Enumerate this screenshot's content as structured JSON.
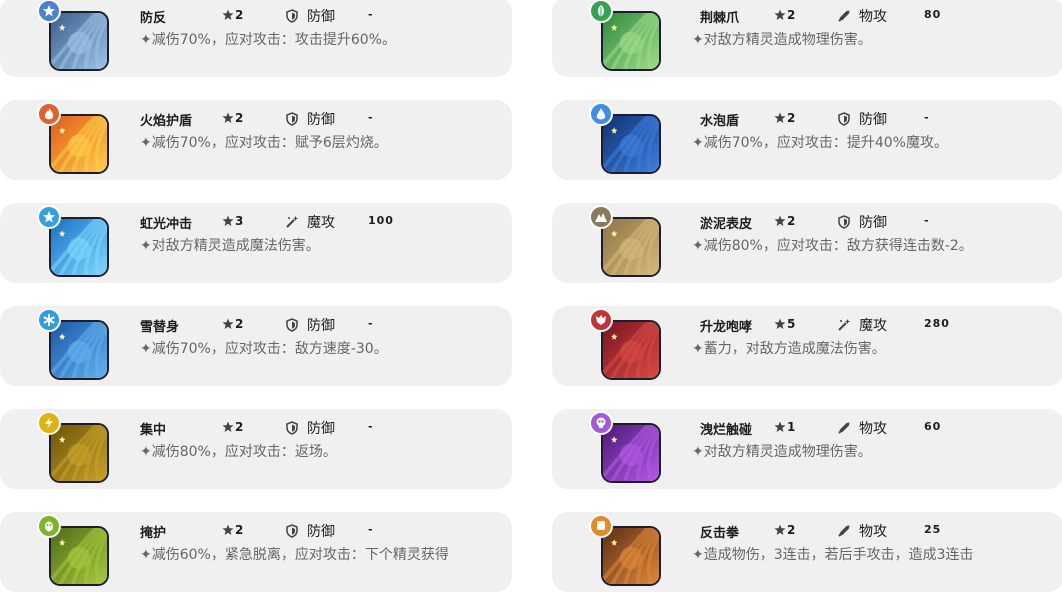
{
  "skills": [
    {
      "name": "防反",
      "cost": "2",
      "category": "防御",
      "power": "-",
      "desc": "✦减伤70%，应对攻击：攻击提升60%。",
      "element_icon": "light-icon",
      "element_color": "#4c82c9",
      "art_colors": [
        "#3b5d8c",
        "#9cc3e6"
      ]
    },
    {
      "name": "荆棘爪",
      "cost": "2",
      "category": "物攻",
      "power": "80",
      "desc": "✦对敌方精灵造成物理伤害。",
      "element_icon": "grass-icon",
      "element_color": "#3aa153",
      "art_colors": [
        "#2f8a3c",
        "#9fdc8b"
      ]
    },
    {
      "name": "火焰护盾",
      "cost": "2",
      "category": "防御",
      "power": "-",
      "desc": "✦减伤70%，应对攻击：赋予6层灼烧。",
      "element_icon": "fire-icon",
      "element_color": "#e1602e",
      "art_colors": [
        "#e05a1a",
        "#ffcf4a"
      ]
    },
    {
      "name": "水泡盾",
      "cost": "2",
      "category": "防御",
      "power": "-",
      "desc": "✦减伤70%，应对攻击：提升40%魔攻。",
      "element_icon": "water-icon",
      "element_color": "#3e8ee6",
      "art_colors": [
        "#10306e",
        "#3d7fe0"
      ]
    },
    {
      "name": "虹光冲击",
      "cost": "3",
      "category": "魔攻",
      "power": "100",
      "desc": "✦对敌方精灵造成魔法伤害。",
      "element_icon": "light-icon",
      "element_color": "#35a0e0",
      "art_colors": [
        "#1b6fc4",
        "#7fd8ff"
      ]
    },
    {
      "name": "淤泥表皮",
      "cost": "2",
      "category": "防御",
      "power": "-",
      "desc": "✦减伤80%，应对攻击：敌方获得连击数-2。",
      "element_icon": "ground-icon",
      "element_color": "#8a7a5c",
      "art_colors": [
        "#8f7447",
        "#d6b97a"
      ]
    },
    {
      "name": "雪替身",
      "cost": "2",
      "category": "防御",
      "power": "-",
      "desc": "✦减伤70%，应对攻击：敌方速度-30。",
      "element_icon": "ice-icon",
      "element_color": "#2f9ce0",
      "art_colors": [
        "#1a55a8",
        "#62b3ee"
      ]
    },
    {
      "name": "升龙咆哮",
      "cost": "5",
      "category": "魔攻",
      "power": "280",
      "desc": "✦蓄力，对敌方造成魔法伤害。",
      "element_icon": "dragon-icon",
      "element_color": "#c2333a",
      "art_colors": [
        "#7a1420",
        "#d94a45"
      ]
    },
    {
      "name": "集中",
      "cost": "2",
      "category": "防御",
      "power": "-",
      "desc": "✦减伤80%，应对攻击：返场。",
      "element_icon": "electric-icon",
      "element_color": "#e0b214",
      "art_colors": [
        "#6b5408",
        "#c9a22a"
      ]
    },
    {
      "name": "洩烂触碰",
      "cost": "1",
      "category": "物攻",
      "power": "60",
      "desc": "✦对敌方精灵造成物理伤害。",
      "element_icon": "poison-icon",
      "element_color": "#a35ad6",
      "art_colors": [
        "#4b1878",
        "#b45ae8"
      ]
    },
    {
      "name": "掩护",
      "cost": "2",
      "category": "防御",
      "power": "-",
      "desc": "✦减伤60%，紧急脱离，应对攻击：下个精灵获得",
      "element_icon": "bug-icon",
      "element_color": "#7cb529",
      "art_colors": [
        "#4d6b1a",
        "#a7c93d"
      ]
    },
    {
      "name": "反击拳",
      "cost": "2",
      "category": "物攻",
      "power": "25",
      "desc": "✦造成物伤，3连击，若后手攻击，造成3连击",
      "element_icon": "fighting-icon",
      "element_color": "#e48a2c",
      "art_colors": [
        "#5a2f14",
        "#e0883a"
      ]
    }
  ]
}
